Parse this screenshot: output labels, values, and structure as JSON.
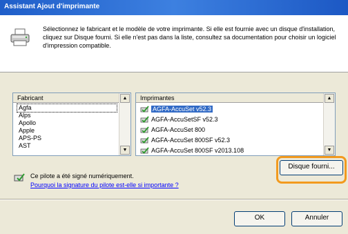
{
  "window": {
    "title": "Assistant Ajout d'imprimante"
  },
  "header": {
    "icon": "printer-icon",
    "description": "Sélectionnez le fabricant et le modèle de votre imprimante. Si elle est fournie avec un disque d'installation, cliquez sur Disque fourni. Si elle n'est pas dans la liste, consultez sa documentation pour choisir un logiciel d'impression compatible."
  },
  "manufacturers": {
    "header": "Fabricant",
    "selected": "Agfa",
    "items": [
      "Agfa",
      "Alps",
      "Apollo",
      "Apple",
      "APS-PS",
      "AST"
    ]
  },
  "printers": {
    "header": "Imprimantes",
    "selected": "AGFA-AccuSet v52.3",
    "items": [
      "AGFA-AccuSet v52.3",
      "AGFA-AccuSetSF v52.3",
      "AGFA-AccuSet 800",
      "AGFA-AccuSet 800SF v52.3",
      "AGFA-AccuSet 800SF v2013.108"
    ]
  },
  "signature": {
    "status": "Ce pilote a été signé numériquement.",
    "link": "Pourquoi la signature du pilote est-elle si importante ?"
  },
  "buttons": {
    "have_disk": "Disque fourni...",
    "ok": "OK",
    "cancel": "Annuler"
  },
  "colors": {
    "title_bar": "#2a6bd6",
    "highlight": "#f29a1e",
    "selection": "#316ac5",
    "link": "#0000ff"
  }
}
